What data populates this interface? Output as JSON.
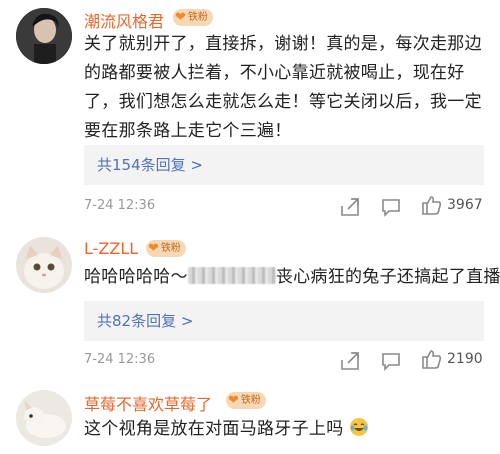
{
  "comments": [
    {
      "username": "潮流风格君",
      "badge": "铁粉",
      "text": "关了就别开了，直接拆，谢谢！真的是，每次走那边的路都要被人拦着，不小心靠近就被喝止，现在好了，我们想怎么走就怎么走！等它关闭以后，我一定要在那条路上走它个三遍！",
      "replies": "共154条回复 >",
      "date": "7-24 12:36",
      "likes": "3967"
    },
    {
      "username": "L-ZZLL",
      "badge": "铁粉",
      "text_before": "哈哈哈哈哈～",
      "text_after": "丧心病狂的兔子还搞起了直播",
      "replies": "共82条回复 >",
      "date": "7-24 12:36",
      "likes": "2190"
    },
    {
      "username": "草莓不喜欢草莓了",
      "badge": "铁粉",
      "text": "这个视角是放在对面马路牙子上吗",
      "emoji": "laughing-crying-emoji"
    }
  ],
  "icons": [
    "share-icon",
    "comment-icon",
    "like-icon"
  ],
  "colors": {
    "username": "#e8672c",
    "link": "#4e73b8",
    "badge_bg": "#f6d8b5"
  }
}
